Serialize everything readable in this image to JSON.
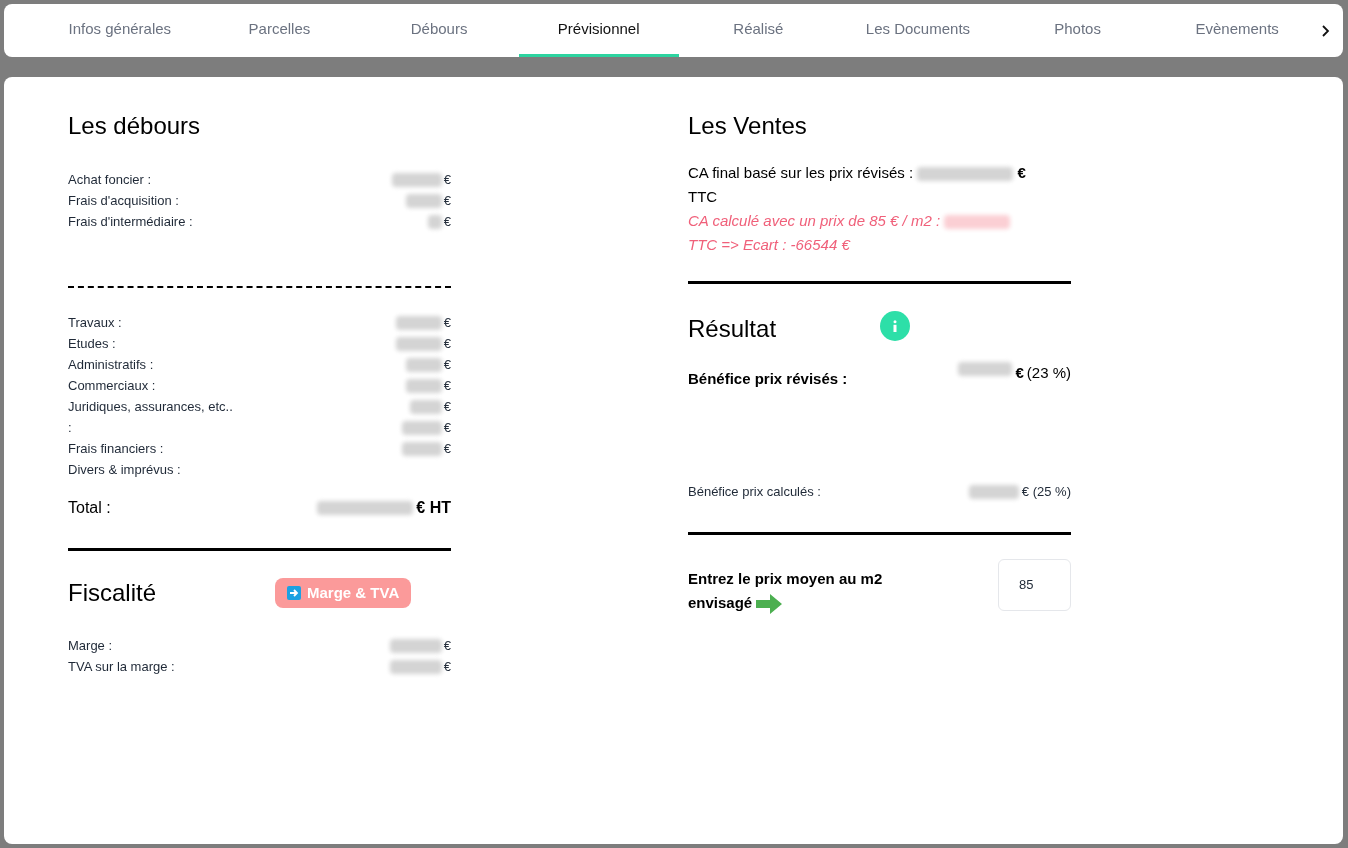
{
  "tabs": [
    {
      "label": "Infos générales",
      "selected": false
    },
    {
      "label": "Parcelles",
      "selected": false
    },
    {
      "label": "Débours",
      "selected": false
    },
    {
      "label": "Prévisionnel",
      "selected": true
    },
    {
      "label": "Réalisé",
      "selected": false
    },
    {
      "label": "Les Documents",
      "selected": false
    },
    {
      "label": "Photos",
      "selected": false
    },
    {
      "label": "Evènements",
      "selected": false
    }
  ],
  "debours": {
    "title": "Les débours",
    "group_1": [
      {
        "label": "Achat foncier :",
        "unit": "€"
      },
      {
        "label": "Frais d'acquisition :",
        "unit": "€"
      },
      {
        "label": "Frais d'intermédiaire :",
        "unit": "€"
      }
    ],
    "group_2": [
      {
        "label": "Travaux :",
        "unit": "€"
      },
      {
        "label": "Etudes :",
        "unit": "€"
      },
      {
        "label": "Administratifs :",
        "unit": "€"
      },
      {
        "label": "Commerciaux :",
        "unit": "€"
      },
      {
        "label": "Juridiques, assurances, etc..",
        "unit": "€"
      },
      {
        "label": ":",
        "unit": "€"
      },
      {
        "label": "Frais financiers :",
        "unit": "€"
      },
      {
        "label": "Divers & imprévus :"
      }
    ],
    "total_label": "Total :",
    "total_unit": "€ HT"
  },
  "fiscalite": {
    "title": "Fiscalité",
    "button": "Marge & TVA",
    "rows": [
      {
        "label": "Marge :",
        "unit": "€"
      },
      {
        "label": "TVA sur la marge :",
        "unit": "€"
      }
    ]
  },
  "ventes": {
    "title": "Les Ventes",
    "ca_final_label": "CA final basé sur les prix révisés :",
    "ca_final_unit": "€",
    "ca_final_suffix": "TTC",
    "ca_calc_label": "CA calculé avec un prix de 85 € / m2 :",
    "ca_calc_suffix": "TTC => Ecart : -66544 €"
  },
  "resultat": {
    "title": "Résultat",
    "benefice_revises_label": "Bénéfice prix révisés :",
    "benefice_revises_unit": "€",
    "benefice_revises_pct": "(23 %)",
    "benefice_calcules_label": "Bénéfice prix calculés :",
    "benefice_calcules_unit": "€ (25 %)",
    "prix_label": "Entrez le prix moyen au m2 envisagé",
    "prix_value": "85"
  }
}
